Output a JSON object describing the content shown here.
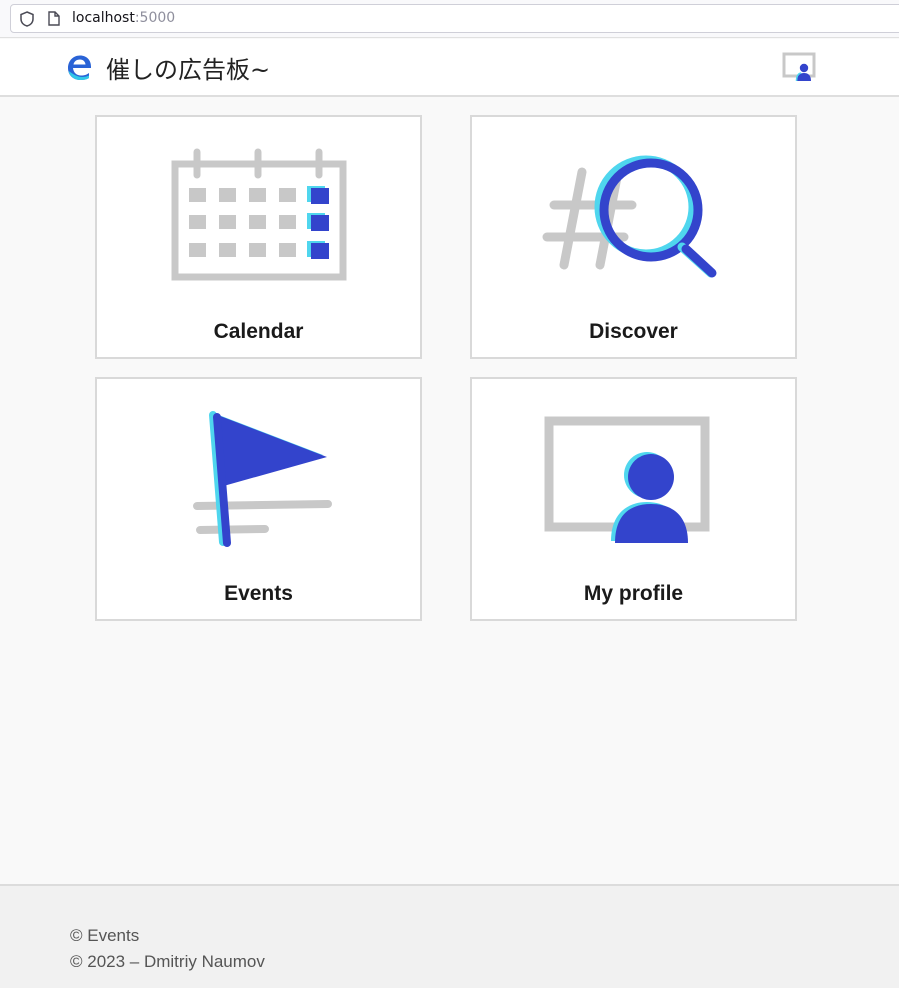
{
  "browser": {
    "url_host": "localhost",
    "url_port": ":5000",
    "icons": [
      "shield-icon",
      "page-icon"
    ]
  },
  "header": {
    "title": "催しの広告板~",
    "logo_icon": "edge-e-logo",
    "profile_icon": "profile-icon"
  },
  "tiles": [
    {
      "label": "Calendar",
      "icon": "calendar-icon"
    },
    {
      "label": "Discover",
      "icon": "hashtag-search-icon"
    },
    {
      "label": "Events",
      "icon": "flag-icon"
    },
    {
      "label": "My profile",
      "icon": "profile-card-icon"
    }
  ],
  "footer": {
    "line1": "© Events",
    "line2": "© 2023 – Dmitriy Naumov"
  },
  "colors": {
    "accent": "#3344cc",
    "accent_shadow": "#4fd6ee",
    "icon_gray": "#c8c8c8"
  }
}
